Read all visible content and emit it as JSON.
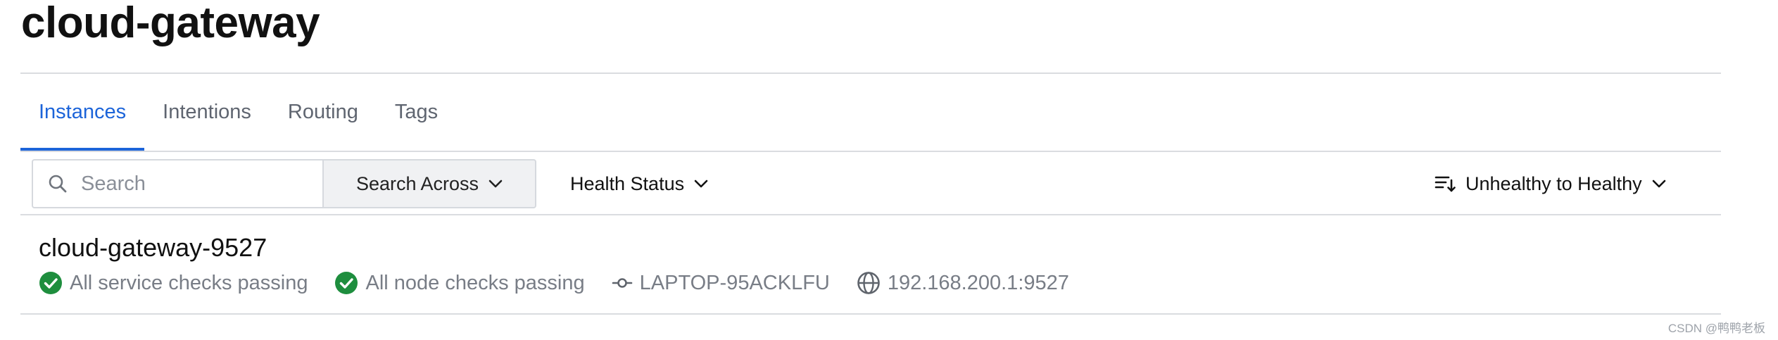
{
  "service": {
    "title": "cloud-gateway"
  },
  "tabs": [
    {
      "label": "Instances",
      "active": true
    },
    {
      "label": "Intentions",
      "active": false
    },
    {
      "label": "Routing",
      "active": false
    },
    {
      "label": "Tags",
      "active": false
    }
  ],
  "filters": {
    "search_placeholder": "Search",
    "search_value": "",
    "search_across_label": "Search Across",
    "health_status_label": "Health Status",
    "sort_label": "Unhealthy to Healthy"
  },
  "instances": [
    {
      "name": "cloud-gateway-9527",
      "service_checks": "All service checks passing",
      "node_checks": "All node checks passing",
      "node": "LAPTOP-95ACKLFU",
      "address": "192.168.200.1:9527"
    }
  ],
  "watermark": "CSDN @鸭鸭老板",
  "colors": {
    "accent": "#1c64d9",
    "passing": "#1e8e3e",
    "muted_text": "#787d86",
    "divider": "#dadce0"
  },
  "icons": {
    "search": "search-icon",
    "chevron": "chevron-down-icon",
    "sort": "sort-icon",
    "check": "check-circle-icon",
    "node": "node-icon",
    "address": "globe-icon"
  }
}
